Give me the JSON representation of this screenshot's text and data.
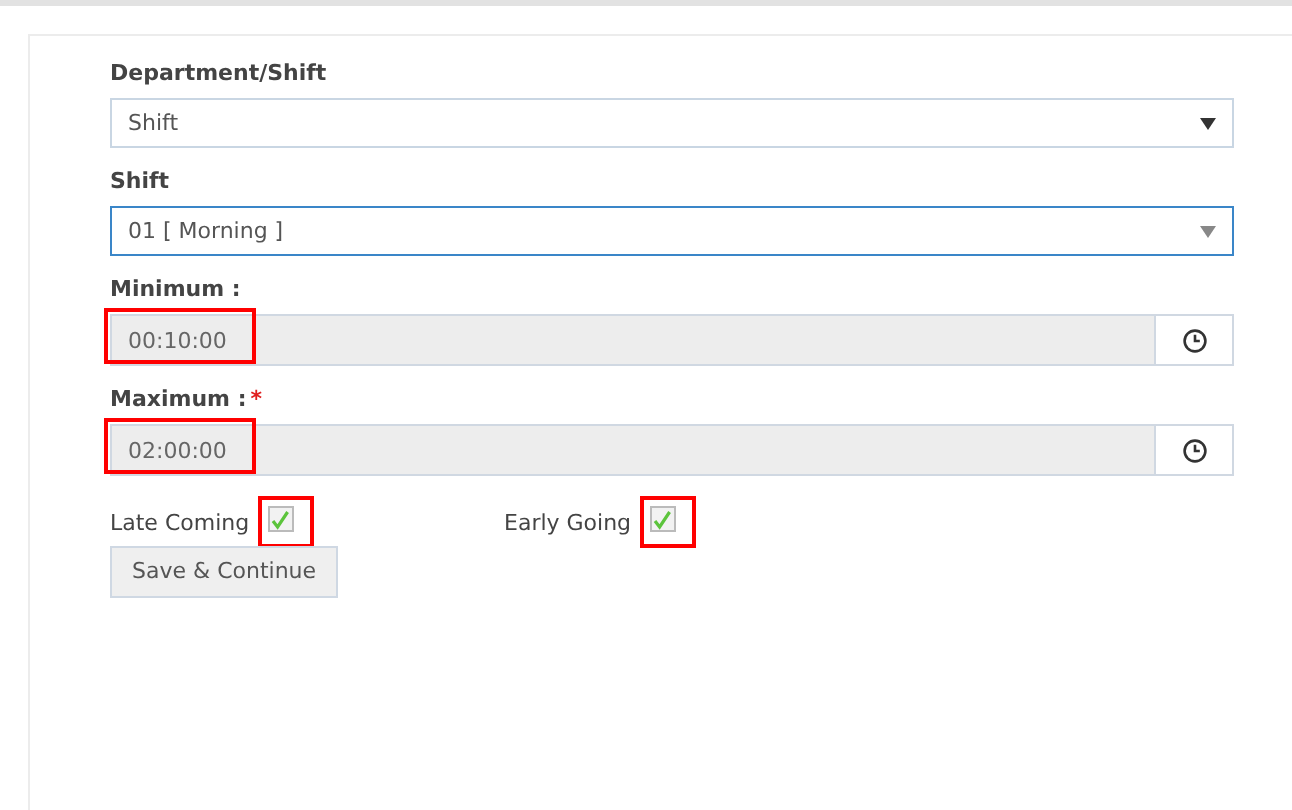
{
  "form": {
    "fields": [
      {
        "kind": "select",
        "label": "Department/Shift",
        "value": "Shift",
        "focused": false
      },
      {
        "kind": "select",
        "label": "Shift",
        "value": "01 [ Morning ]",
        "focused": true
      },
      {
        "kind": "time",
        "label": "Minimum :",
        "value": "00:10:00",
        "highlighted": true
      },
      {
        "kind": "time",
        "label": "Maximum :",
        "required_mark": "*",
        "value": "02:00:00",
        "highlighted": true
      }
    ],
    "checkboxes": [
      {
        "label": "Late Coming",
        "checked": true,
        "highlighted": true
      },
      {
        "label": "Early Going",
        "checked": true,
        "highlighted": true
      }
    ],
    "submit": "Save & Continue"
  }
}
